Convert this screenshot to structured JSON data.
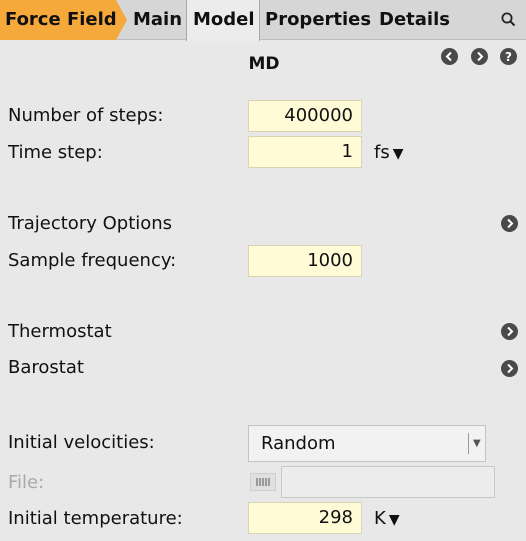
{
  "tabs": {
    "forcefield": "Force Field",
    "main": "Main",
    "model": "Model",
    "properties": "Properties",
    "details": "Details"
  },
  "section": {
    "title": "MD"
  },
  "fields": {
    "num_steps": {
      "label": "Number of steps:",
      "value": "400000"
    },
    "time_step": {
      "label": "Time step:",
      "value": "1",
      "unit": "fs"
    },
    "trajectory_options": {
      "label": "Trajectory Options"
    },
    "sample_frequency": {
      "label": "Sample frequency:",
      "value": "1000"
    },
    "thermostat": {
      "label": "Thermostat"
    },
    "barostat": {
      "label": "Barostat"
    },
    "initial_velocities": {
      "label": "Initial velocities:",
      "value": "Random"
    },
    "file": {
      "label": "File:",
      "value": ""
    },
    "initial_temperature": {
      "label": "Initial temperature:",
      "value": "298",
      "unit": "K"
    }
  },
  "icons": {
    "search": "search-icon",
    "prev": "chevron-left-icon",
    "next": "chevron-right-icon",
    "more": "chevron-right-icon",
    "file": "file-browse-icon"
  },
  "colors": {
    "active_tab": "#f5a93a",
    "field_bg": "#fffbd6",
    "panel_bg": "#e8e8e8"
  }
}
